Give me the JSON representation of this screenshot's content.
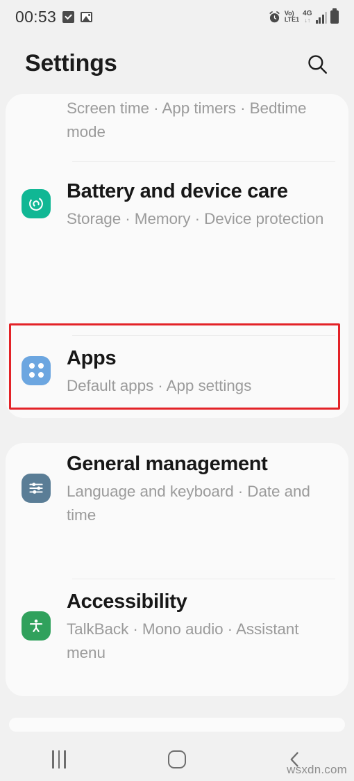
{
  "status_bar": {
    "clock": "00:53",
    "left_icons": [
      "checkbox-checked-icon",
      "image-icon"
    ],
    "alarm_icon": "alarm-clock-icon",
    "volte_top": "Vo)",
    "volte_bottom": "LTE1",
    "network_type": "4G",
    "data_arrows": "↓↑",
    "signal_icon": "signal-bars-icon",
    "battery_icon": "battery-full-icon"
  },
  "header": {
    "title": "Settings",
    "search_icon": "search-icon"
  },
  "cards": [
    {
      "id": "card-a",
      "rows": [
        {
          "name": "digital-wellbeing",
          "title": "",
          "subtitle": "Screen time · App timers · Bedtime mode",
          "icon": "hourglass-icon",
          "icon_color": "#4a72b8",
          "clipped": true
        },
        {
          "name": "battery-and-device-care",
          "title": "Battery and device care",
          "subtitle": "Storage · Memory · Device protection",
          "icon": "device-care-icon",
          "icon_color": "#10b794"
        },
        {
          "name": "apps",
          "title": "Apps",
          "subtitle": "Default apps · App settings",
          "icon": "apps-grid-icon",
          "icon_color": "#6ca6e0",
          "highlighted": true
        }
      ]
    },
    {
      "id": "card-b",
      "rows": [
        {
          "name": "general-management",
          "title": "General management",
          "subtitle": "Language and keyboard · Date and time",
          "icon": "sliders-icon",
          "icon_color": "#5a7d96"
        },
        {
          "name": "accessibility",
          "title": "Accessibility",
          "subtitle": "TalkBack · Mono audio · Assistant menu",
          "icon": "accessibility-person-icon",
          "icon_color": "#30a15c"
        }
      ]
    }
  ],
  "highlight": {
    "target": "apps",
    "color": "#e32227"
  },
  "nav_bar": {
    "recents_label": "recents-icon",
    "home_label": "home-icon",
    "back_label": "back-icon"
  },
  "watermark": "wsxdn.com"
}
